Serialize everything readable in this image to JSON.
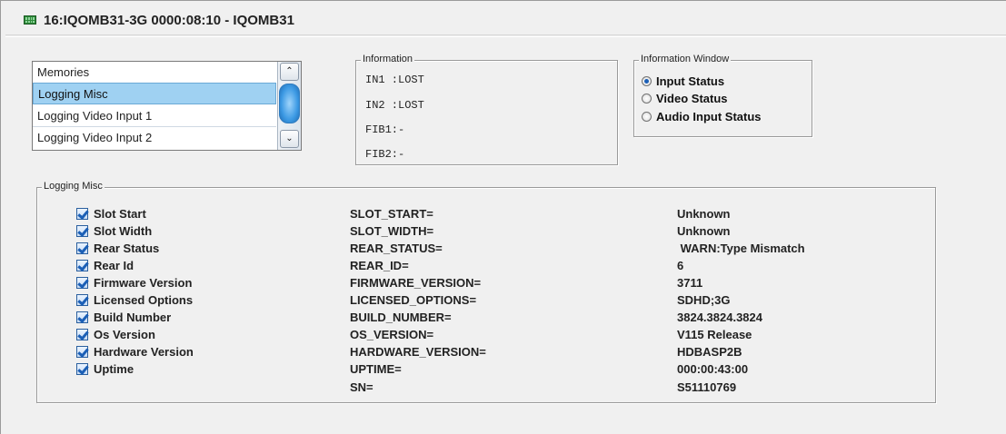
{
  "window": {
    "title": "16:IQOMB31-3G  0000:08:10  - IQOMB31",
    "icon": "module-icon"
  },
  "memories": {
    "items": [
      {
        "label": "Memories",
        "selected": false
      },
      {
        "label": "Logging Misc",
        "selected": true
      },
      {
        "label": "Logging Video Input 1",
        "selected": false
      },
      {
        "label": "Logging Video Input 2",
        "selected": false
      }
    ],
    "scroll_up_glyph": "⌃",
    "scroll_down_glyph": "⌄"
  },
  "information": {
    "legend": "Information",
    "lines": [
      "IN1 :LOST",
      "IN2 :LOST",
      "FIB1:-",
      "FIB2:-"
    ]
  },
  "information_window": {
    "legend": "Information Window",
    "options": [
      {
        "label": "Input Status",
        "checked": true
      },
      {
        "label": "Video Status",
        "checked": false
      },
      {
        "label": "Audio Input Status",
        "checked": false
      }
    ]
  },
  "logging_misc": {
    "legend": "Logging Misc",
    "rows": [
      {
        "label": "Slot Start",
        "key": "SLOT_START=",
        "value": "Unknown",
        "checkbox": true
      },
      {
        "label": "Slot Width",
        "key": "SLOT_WIDTH=",
        "value": "Unknown",
        "checkbox": true
      },
      {
        "label": "Rear Status",
        "key": "REAR_STATUS=",
        "value": " WARN:Type Mismatch",
        "checkbox": true
      },
      {
        "label": "Rear Id",
        "key": "REAR_ID=",
        "value": "6",
        "checkbox": true
      },
      {
        "label": "Firmware Version",
        "key": "FIRMWARE_VERSION=",
        "value": "3711",
        "checkbox": true
      },
      {
        "label": "Licensed Options",
        "key": "LICENSED_OPTIONS=",
        "value": "SDHD;3G",
        "checkbox": true
      },
      {
        "label": "Build Number",
        "key": "BUILD_NUMBER=",
        "value": "3824.3824.3824",
        "checkbox": true
      },
      {
        "label": "Os Version",
        "key": "OS_VERSION=",
        "value": "V115 Release",
        "checkbox": true
      },
      {
        "label": "Hardware Version",
        "key": "HARDWARE_VERSION=",
        "value": "HDBASP2B",
        "checkbox": true
      },
      {
        "label": "Uptime",
        "key": "UPTIME=",
        "value": "000:00:43:00",
        "checkbox": true
      },
      {
        "label": "",
        "key": "SN=",
        "value": "S51110769",
        "checkbox": false
      }
    ]
  },
  "colors": {
    "selection": "#9fd1f2",
    "accent": "#1b5fb6",
    "background": "#f0f0f0"
  }
}
